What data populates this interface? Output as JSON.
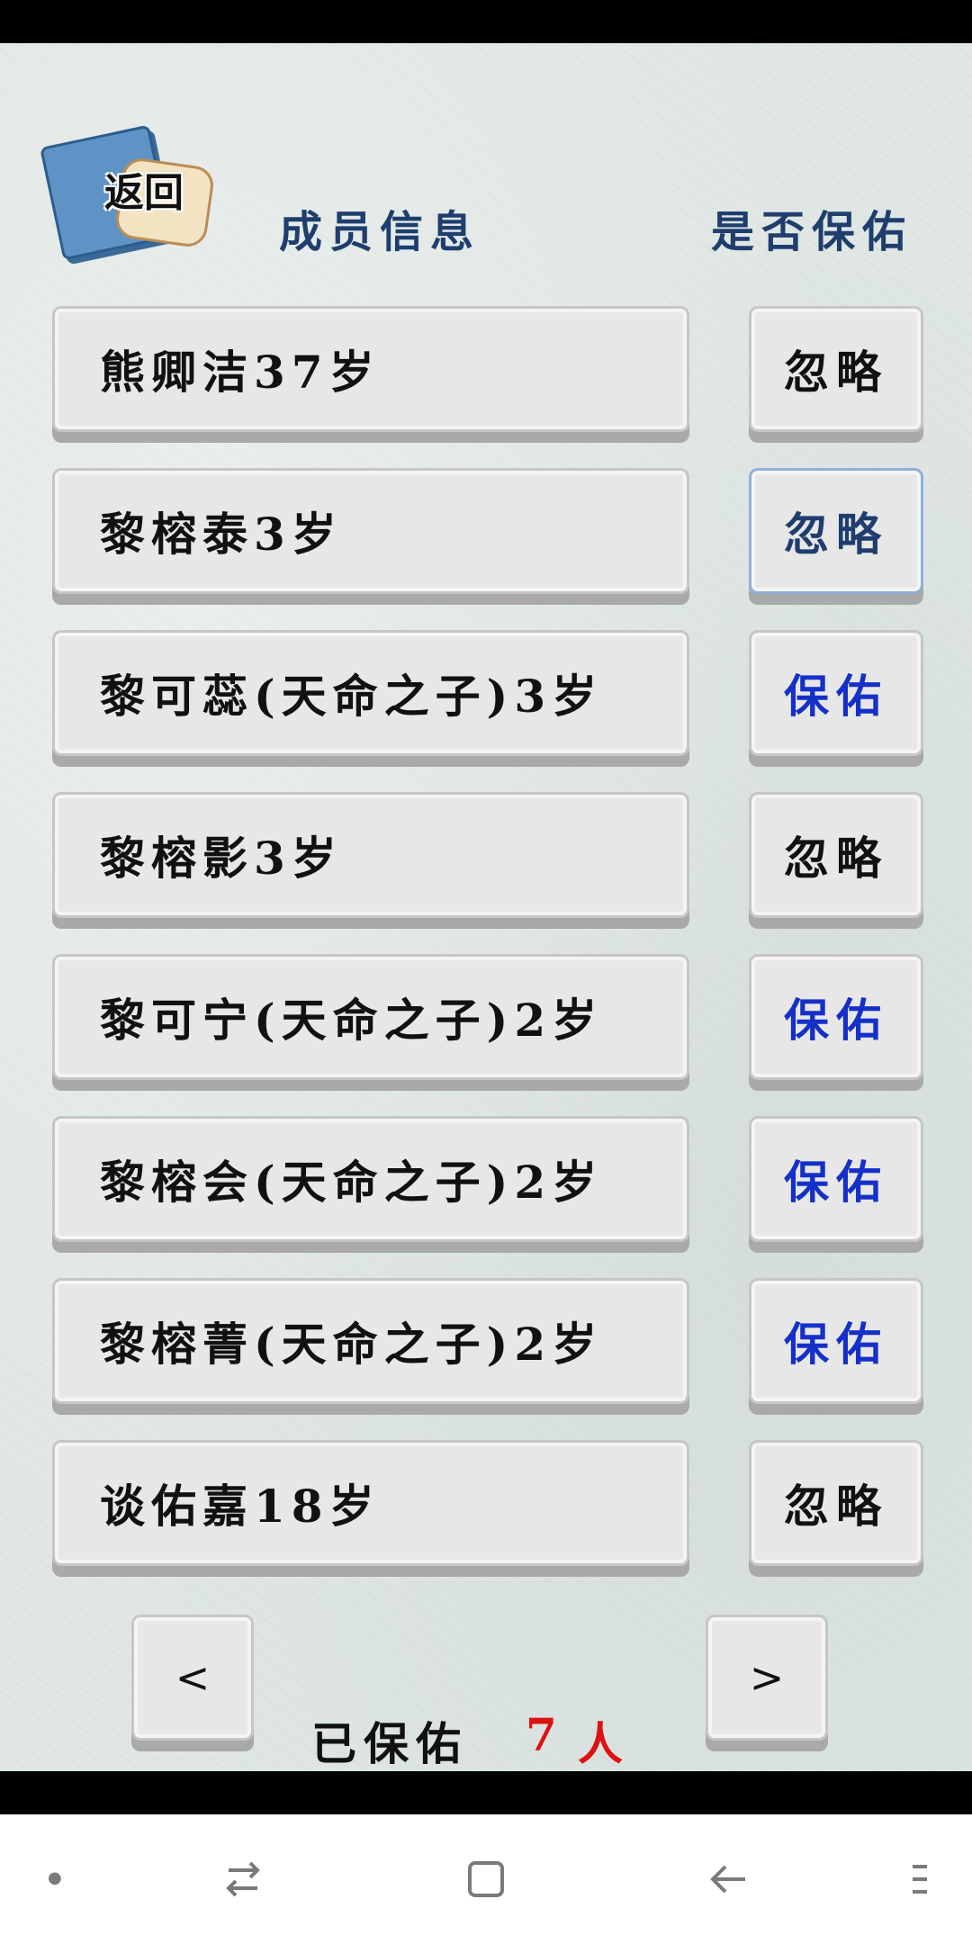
{
  "app": {
    "back_label": "返回",
    "header_member_info": "成员信息",
    "header_bless_question": "是否保佑"
  },
  "members": [
    {
      "name": "熊卿洁37岁",
      "action": "忽略",
      "state": "ignore"
    },
    {
      "name": "黎榕泰3岁",
      "action": "忽略",
      "state": "ignore-selected"
    },
    {
      "name": "黎可蕊(天命之子)3岁",
      "action": "保佑",
      "state": "bless"
    },
    {
      "name": "黎榕影3岁",
      "action": "忽略",
      "state": "ignore"
    },
    {
      "name": "黎可宁(天命之子)2岁",
      "action": "保佑",
      "state": "bless"
    },
    {
      "name": "黎榕会(天命之子)2岁",
      "action": "保佑",
      "state": "bless"
    },
    {
      "name": "黎榕菁(天命之子)2岁",
      "action": "保佑",
      "state": "bless"
    },
    {
      "name": "谈佑嘉18岁",
      "action": "忽略",
      "state": "ignore"
    }
  ],
  "footer": {
    "prev": "<",
    "next": ">",
    "blessed_label": "已保佑",
    "blessed_count": "7",
    "blessed_unit": "人"
  },
  "system_nav": {
    "items": [
      "dot-icon",
      "recent-apps-icon",
      "home-icon",
      "back-arrow-icon",
      "menu-icon"
    ]
  },
  "colors": {
    "header_text": "#1f3e6e",
    "bless_text": "#1530c8",
    "count_text": "#dd1111"
  }
}
